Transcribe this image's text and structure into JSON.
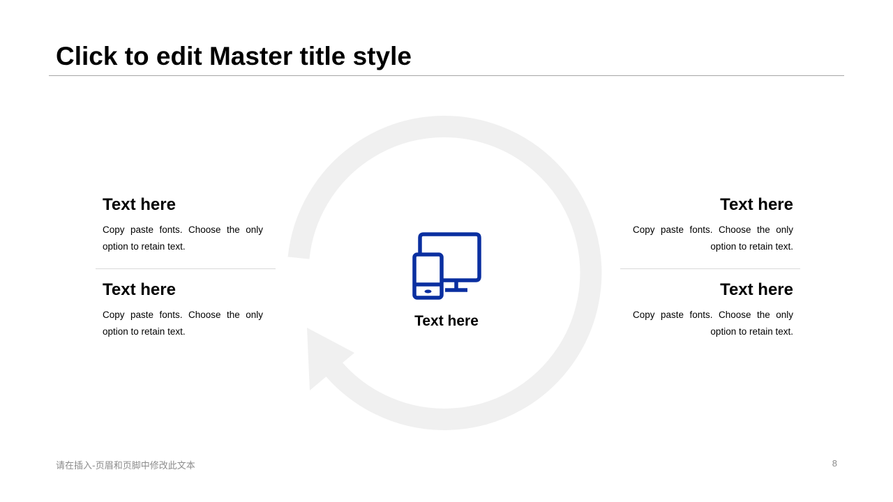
{
  "slide": {
    "title": "Click to edit Master title style",
    "center": {
      "icon": "devices-icon",
      "label": "Text here"
    },
    "left_blocks": [
      {
        "heading": "Text here",
        "body": "Copy paste fonts. Choose the only option to retain text."
      },
      {
        "heading": "Text here",
        "body": "Copy paste fonts. Choose the only option to retain text."
      }
    ],
    "right_blocks": [
      {
        "heading": "Text here",
        "body": "Copy paste fonts. Choose the only option to retain text."
      },
      {
        "heading": "Text here",
        "body": "Copy paste fonts. Choose the only option to retain text."
      }
    ],
    "footer": {
      "text": "请在插入-页眉和页脚中修改此文本",
      "page_number": "8"
    }
  },
  "colors": {
    "accent": "#0a2fa0",
    "cycle_arrow": "#f0f0f0",
    "divider": "#d9d9d9",
    "title_rule": "#a6a6a6",
    "footer_text": "#8c8c8c"
  }
}
